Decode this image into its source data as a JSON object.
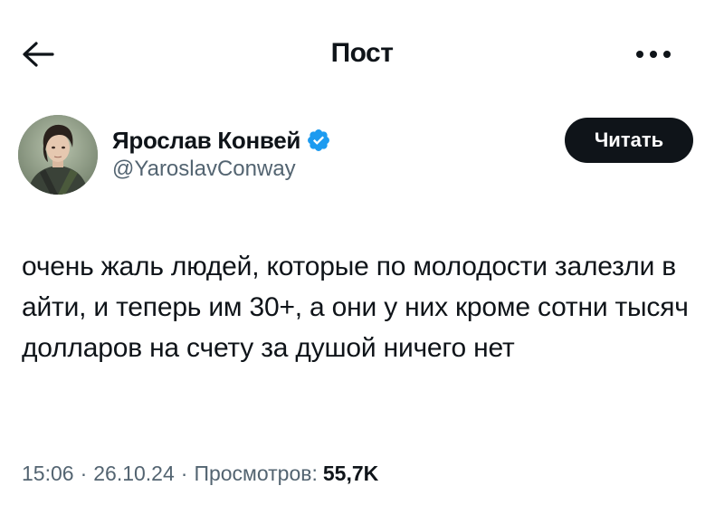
{
  "header": {
    "title": "Пост"
  },
  "author": {
    "name": "Ярослав Конвей",
    "handle": "@YaroslavConway",
    "verified": true,
    "follow_label": "Читать"
  },
  "tweet": {
    "text": "очень жаль людей, которые по молодости залезли в айти, и теперь им 30+, а они у них кроме сотни тысяч долларов на счету за душой ничего нет"
  },
  "meta": {
    "time": "15:06",
    "separator": "·",
    "date": "26.10.24",
    "views_label": "Просмотров:",
    "views_count": "55,7K"
  },
  "colors": {
    "text_primary": "#0f1419",
    "text_secondary": "#536471",
    "verified_blue": "#1d9bf0",
    "button_bg": "#0f1419"
  },
  "icons": {
    "back": "arrow-left-icon",
    "more": "more-horizontal-icon",
    "verified": "verified-badge-icon"
  }
}
